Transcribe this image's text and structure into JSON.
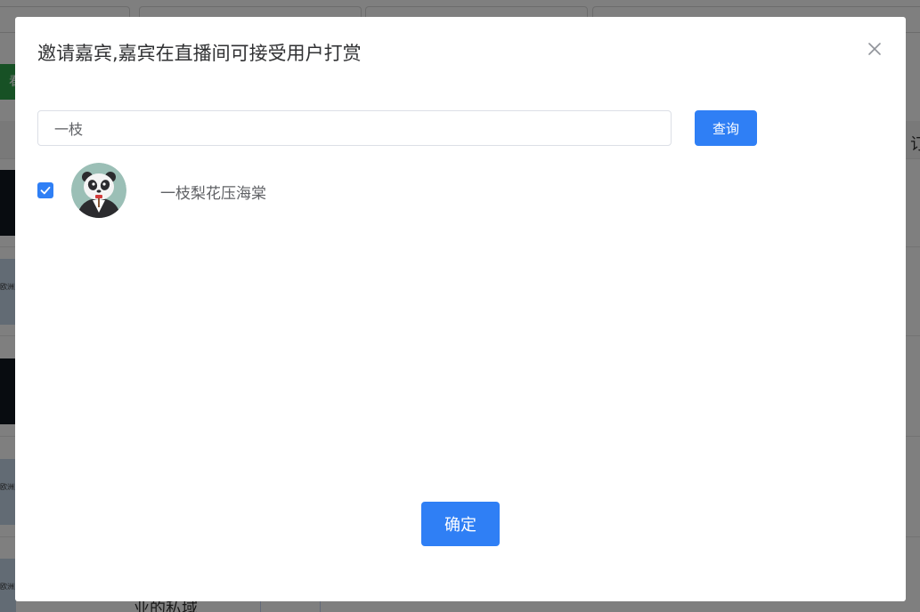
{
  "background": {
    "header_fragment": "订",
    "green_button_fragment": "看",
    "thumb_labels": [
      "欧洲民众",
      "欧洲民众",
      "欧洲民众"
    ],
    "bottom_text_fragment": "业的私域"
  },
  "dialog": {
    "title": "邀请嘉宾,嘉宾在直播间可接受用户打赏",
    "search": {
      "value": "一枝",
      "placeholder": ""
    },
    "query_button_label": "查询",
    "results": [
      {
        "name": "一枝梨花压海棠",
        "checked": true,
        "avatar_icon": "panda-avatar"
      }
    ],
    "confirm_button_label": "确定"
  },
  "colors": {
    "primary": "#2f7ff5",
    "title_text": "#303133",
    "body_text": "#606266",
    "overlay": "rgba(0,0,0,0.5)"
  }
}
